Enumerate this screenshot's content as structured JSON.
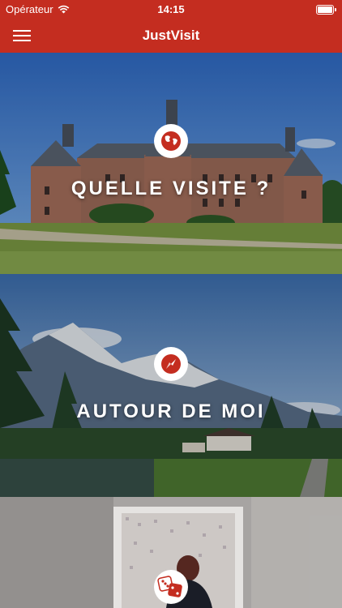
{
  "status_bar": {
    "carrier": "Opérateur",
    "time": "14:15"
  },
  "nav": {
    "title": "JustVisit",
    "menu_icon": "hamburger-menu-icon"
  },
  "tiles": [
    {
      "label": "QUELLE VISITE ?",
      "icon": "globe-icon"
    },
    {
      "label": "AUTOUR DE MOI",
      "icon": "compass-icon"
    },
    {
      "label": "",
      "icon": "dice-icon"
    }
  ],
  "colors": {
    "brand_red": "#c42d20",
    "icon_circle": "#ffffff"
  }
}
